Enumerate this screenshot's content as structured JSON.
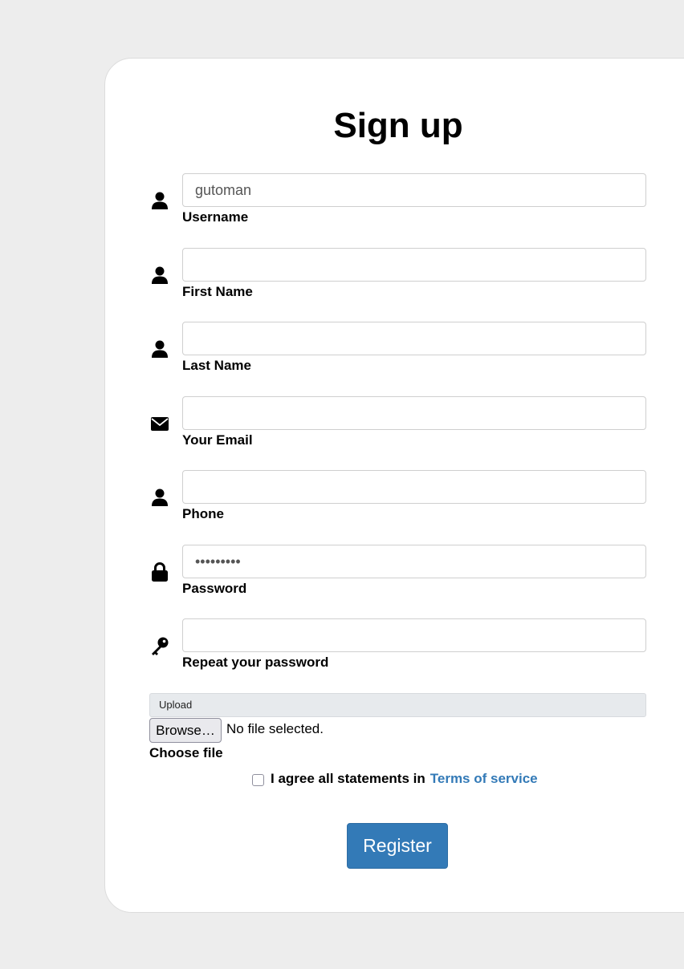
{
  "page": {
    "title": "Sign up"
  },
  "form": {
    "fields": [
      {
        "label": "Username",
        "value": "gutoman",
        "type": "text",
        "icon": "user-icon"
      },
      {
        "label": "First Name",
        "value": "",
        "type": "text",
        "icon": "user-icon"
      },
      {
        "label": "Last Name",
        "value": "",
        "type": "text",
        "icon": "user-icon"
      },
      {
        "label": "Your Email",
        "value": "",
        "type": "email",
        "icon": "envelope-icon"
      },
      {
        "label": "Phone",
        "value": "",
        "type": "text",
        "icon": "user-icon"
      },
      {
        "label": "Password",
        "value": "•••••••••",
        "type": "password",
        "icon": "lock-icon"
      },
      {
        "label": "Repeat your password",
        "value": "",
        "type": "password",
        "icon": "key-icon"
      }
    ],
    "upload": {
      "bar_label": "Upload",
      "browse_label": "Browse…",
      "status": "No file selected.",
      "label": "Choose file"
    },
    "agree": {
      "text": "I agree all statements in",
      "link": "Terms of service",
      "checked": false
    },
    "submit_label": "Register"
  },
  "colors": {
    "background": "#ededed",
    "card": "#ffffff",
    "accent": "#337ab7",
    "upload_bar": "#e7eaed"
  }
}
